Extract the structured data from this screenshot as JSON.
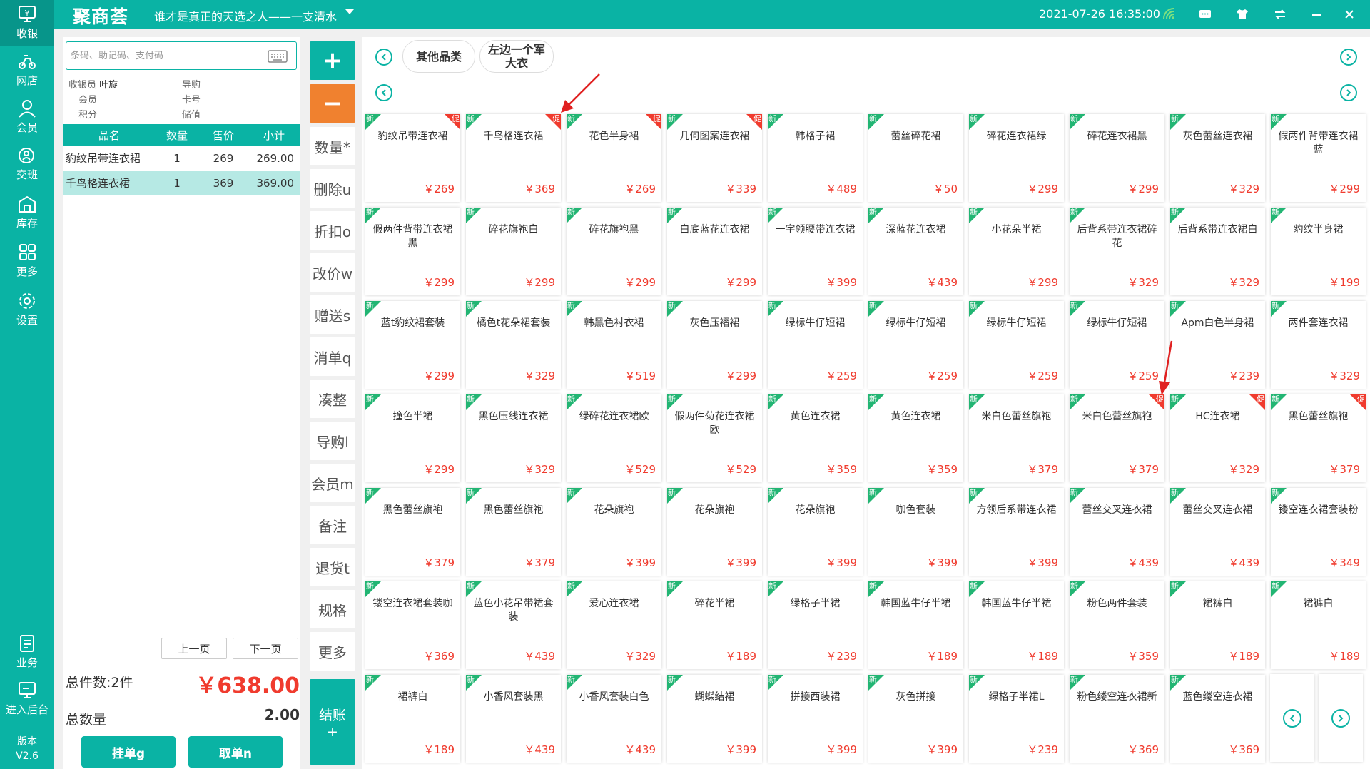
{
  "app": {
    "logo": "聚商荟",
    "slogan": "谁才是真正的天选之人——一支清水",
    "datetime": "2021-07-26 16:35:00"
  },
  "sidebar": {
    "items": [
      {
        "label": "收银",
        "icon": "cashier-icon",
        "active": true
      },
      {
        "label": "网店",
        "icon": "shop-icon"
      },
      {
        "label": "会员",
        "icon": "member-icon"
      },
      {
        "label": "交班",
        "icon": "shift-icon"
      },
      {
        "label": "库存",
        "icon": "warehouse-icon"
      },
      {
        "label": "更多",
        "icon": "grid-icon"
      },
      {
        "label": "设置",
        "icon": "gear-icon"
      }
    ],
    "bottom_items": [
      {
        "label": "业务",
        "icon": "business-icon"
      },
      {
        "label": "进入后台",
        "icon": "backend-icon"
      }
    ],
    "version_label": "版本",
    "version": "V2.6"
  },
  "search": {
    "placeholder": "条码、助记码、支付码"
  },
  "info": {
    "cashier_label": "收银员",
    "cashier_value": "叶旋",
    "guide_label": "导购",
    "member_label": "会员",
    "card_label": "卡号",
    "points_label": "积分",
    "balance_label": "储值"
  },
  "cart": {
    "headers": [
      "品名",
      "数量",
      "售价",
      "小计"
    ],
    "rows": [
      {
        "name": "豹纹吊带连衣裙",
        "qty": "1",
        "price": "269",
        "subtotal": "269.00"
      },
      {
        "name": "千鸟格连衣裙",
        "qty": "1",
        "price": "369",
        "subtotal": "369.00"
      }
    ],
    "prev_page": "上一页",
    "next_page": "下一页",
    "total_items_label": "总件数:2件",
    "total_amount": "￥638.00",
    "total_qty_label": "总数量",
    "total_qty": "2.00",
    "hold_button": "挂单g",
    "retrieve_button": "取单n"
  },
  "actions": {
    "plus": "+",
    "minus": "−",
    "items": [
      "数量*",
      "删除u",
      "折扣o",
      "改价w",
      "赠送s",
      "消单q",
      "凑整",
      "导购l",
      "会员m",
      "备注",
      "退货t",
      "规格",
      "更多"
    ],
    "checkout_line1": "结账",
    "checkout_line2": "+"
  },
  "categories": [
    "其他品类",
    "左边一个军大衣"
  ],
  "badges": {
    "new": "新",
    "promo": "促"
  },
  "products": [
    {
      "name": "豹纹吊带连衣裙",
      "price": "￥269",
      "promo": true
    },
    {
      "name": "千鸟格连衣裙",
      "price": "￥369",
      "promo": true
    },
    {
      "name": "花色半身裙",
      "price": "￥269",
      "promo": true
    },
    {
      "name": "几何图案连衣裙",
      "price": "￥339",
      "promo": true
    },
    {
      "name": "韩格子裙",
      "price": "￥489",
      "promo": false
    },
    {
      "name": "蕾丝碎花裙",
      "price": "￥50",
      "promo": false
    },
    {
      "name": "碎花连衣裙绿",
      "price": "￥299",
      "promo": false
    },
    {
      "name": "碎花连衣裙黑",
      "price": "￥299",
      "promo": false
    },
    {
      "name": "灰色蕾丝连衣裙",
      "price": "￥329",
      "promo": false
    },
    {
      "name": "假两件背带连衣裙蓝",
      "price": "￥299",
      "promo": false
    },
    {
      "name": "假两件背带连衣裙黑",
      "price": "￥299",
      "promo": false
    },
    {
      "name": "碎花旗袍白",
      "price": "￥299",
      "promo": false
    },
    {
      "name": "碎花旗袍黑",
      "price": "￥299",
      "promo": false
    },
    {
      "name": "白底蓝花连衣裙",
      "price": "￥299",
      "promo": false
    },
    {
      "name": "一字领腰带连衣裙",
      "price": "￥399",
      "promo": false
    },
    {
      "name": "深蓝花连衣裙",
      "price": "￥439",
      "promo": false
    },
    {
      "name": "小花朵半裙",
      "price": "￥299",
      "promo": false
    },
    {
      "name": "后背系带连衣裙碎花",
      "price": "￥329",
      "promo": false
    },
    {
      "name": "后背系带连衣裙白",
      "price": "￥329",
      "promo": false
    },
    {
      "name": "豹纹半身裙",
      "price": "￥199",
      "promo": false
    },
    {
      "name": "蓝t豹纹裙套装",
      "price": "￥299",
      "promo": false
    },
    {
      "name": "橘色t花朵裙套装",
      "price": "￥329",
      "promo": false
    },
    {
      "name": "韩黑色衬衣裙",
      "price": "￥519",
      "promo": false
    },
    {
      "name": "灰色压褶裙",
      "price": "￥299",
      "promo": false
    },
    {
      "name": "绿标牛仔短裙",
      "price": "￥259",
      "promo": false
    },
    {
      "name": "绿标牛仔短裙",
      "price": "￥259",
      "promo": false
    },
    {
      "name": "绿标牛仔短裙",
      "price": "￥259",
      "promo": false
    },
    {
      "name": "绿标牛仔短裙",
      "price": "￥259",
      "promo": false
    },
    {
      "name": "Apm白色半身裙",
      "price": "￥239",
      "promo": false
    },
    {
      "name": "两件套连衣裙",
      "price": "￥329",
      "promo": false
    },
    {
      "name": "撞色半裙",
      "price": "￥299",
      "promo": false
    },
    {
      "name": "黑色压线连衣裙",
      "price": "￥329",
      "promo": false
    },
    {
      "name": "绿碎花连衣裙欧",
      "price": "￥529",
      "promo": false
    },
    {
      "name": "假两件菊花连衣裙欧",
      "price": "￥529",
      "promo": false
    },
    {
      "name": "黄色连衣裙",
      "price": "￥359",
      "promo": false
    },
    {
      "name": "黄色连衣裙",
      "price": "￥359",
      "promo": false
    },
    {
      "name": "米白色蕾丝旗袍",
      "price": "￥379",
      "promo": false
    },
    {
      "name": "米白色蕾丝旗袍",
      "price": "￥379",
      "promo": true
    },
    {
      "name": "HC连衣裙",
      "price": "￥329",
      "promo": true
    },
    {
      "name": "黑色蕾丝旗袍",
      "price": "￥379",
      "promo": true
    },
    {
      "name": "黑色蕾丝旗袍",
      "price": "￥379",
      "promo": false
    },
    {
      "name": "黑色蕾丝旗袍",
      "price": "￥379",
      "promo": false
    },
    {
      "name": "花朵旗袍",
      "price": "￥399",
      "promo": false
    },
    {
      "name": "花朵旗袍",
      "price": "￥399",
      "promo": false
    },
    {
      "name": "花朵旗袍",
      "price": "￥399",
      "promo": false
    },
    {
      "name": "咖色套装",
      "price": "￥399",
      "promo": false
    },
    {
      "name": "方领后系带连衣裙",
      "price": "￥399",
      "promo": false
    },
    {
      "name": "蕾丝交叉连衣裙",
      "price": "￥439",
      "promo": false
    },
    {
      "name": "蕾丝交叉连衣裙",
      "price": "￥439",
      "promo": false
    },
    {
      "name": "镂空连衣裙套装粉",
      "price": "￥349",
      "promo": false
    },
    {
      "name": "镂空连衣裙套装咖",
      "price": "￥369",
      "promo": false
    },
    {
      "name": "蓝色小花吊带裙套装",
      "price": "￥439",
      "promo": false
    },
    {
      "name": "爱心连衣裙",
      "price": "￥329",
      "promo": false
    },
    {
      "name": "碎花半裙",
      "price": "￥189",
      "promo": false
    },
    {
      "name": "绿格子半裙",
      "price": "￥239",
      "promo": false
    },
    {
      "name": "韩国蓝牛仔半裙",
      "price": "￥189",
      "promo": false
    },
    {
      "name": "韩国蓝牛仔半裙",
      "price": "￥189",
      "promo": false
    },
    {
      "name": "粉色两件套装",
      "price": "￥359",
      "promo": false
    },
    {
      "name": "裙裤白",
      "price": "￥189",
      "promo": false
    },
    {
      "name": "裙裤白",
      "price": "￥189",
      "promo": false
    },
    {
      "name": "裙裤白",
      "price": "￥189",
      "promo": false
    },
    {
      "name": "小香风套装黑",
      "price": "￥439",
      "promo": false
    },
    {
      "name": "小香风套装白色",
      "price": "￥439",
      "promo": false
    },
    {
      "name": "蝴蝶结裙",
      "price": "￥399",
      "promo": false
    },
    {
      "name": "拼接西装裙",
      "price": "￥399",
      "promo": false
    },
    {
      "name": "灰色拼接",
      "price": "￥399",
      "promo": false
    },
    {
      "name": "绿格子半裙L",
      "price": "￥239",
      "promo": false
    },
    {
      "name": "粉色缕空连衣裙新",
      "price": "￥369",
      "promo": false
    },
    {
      "name": "蓝色缕空连衣裙",
      "price": "￥369",
      "promo": false
    }
  ],
  "colors": {
    "brand": "#0ab3a4",
    "accent_orange": "#f0812f",
    "price_red": "#f03b2e",
    "new_badge": "#22b573"
  }
}
